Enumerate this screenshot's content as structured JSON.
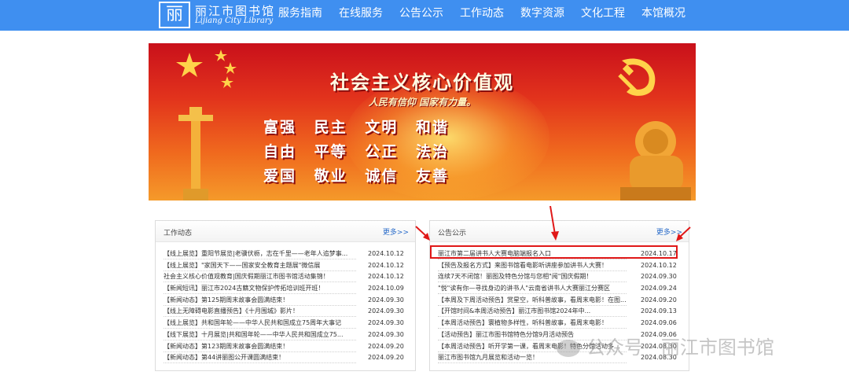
{
  "header": {
    "logo_glyph": "丽",
    "logo_cn": "丽江市图书馆",
    "logo_en": "Lijiang City Library",
    "nav": [
      "服务指南",
      "在线服务",
      "公告公示",
      "工作动态",
      "数字资源",
      "文化工程",
      "本馆概况"
    ]
  },
  "banner": {
    "title": "社会主义核心价值观",
    "subtitle": "人民有信仰 国家有力量。",
    "row1": "富强 民主 文明 和谐",
    "row2": "自由 平等 公正 法治",
    "row3": "爱国 敬业 诚信 友善"
  },
  "work_news": {
    "title": "工作动态",
    "more": "更多>>",
    "items": [
      {
        "text": "【线上展览】重阳节展览|老骥伏枥，志在千里——老年人追梦事...",
        "date": "2024.10.12"
      },
      {
        "text": "【线上展览】\"家国天下——国家安全教育主题展\"微信展",
        "date": "2024.10.12"
      },
      {
        "text": "社会主义核心价值观教育|国庆假期丽江市图书馆活动集锦！",
        "date": "2024.10.12"
      },
      {
        "text": "【新闻短讯】丽江市2024古籍文物保护传拓培训班开班！",
        "date": "2024.10.09"
      },
      {
        "text": "【新闻动态】第125期周末故事会圆满结束！",
        "date": "2024.09.30"
      },
      {
        "text": "【线上无障碍电影直播预告】《十月围城》影片！",
        "date": "2024.09.30"
      },
      {
        "text": "【线上展览】共和国年轮——中华人民共和国成立75周年大事记",
        "date": "2024.09.30"
      },
      {
        "text": "【线下展览】十月展览|共和国年轮——中华人民共和国成立75...",
        "date": "2024.09.30"
      },
      {
        "text": "【新闻动态】第123期周末故事会圆满结束！",
        "date": "2024.09.20"
      },
      {
        "text": "【新闻动态】第44讲丽图公开课圆满结束！",
        "date": "2024.09.20"
      }
    ]
  },
  "announcements": {
    "title": "公告公示",
    "more": "更多>>",
    "items": [
      {
        "text": "丽江市第二届讲书人大赛电脑端报名入口",
        "date": "2024.10.17"
      },
      {
        "text": "【预告及报名方式】来图书馆看电影听讲座参加讲书人大赛！",
        "date": "2024.10.12"
      },
      {
        "text": "连续7天不闭馆！丽图及特色分馆与您相\"阅\"国庆假期！",
        "date": "2024.09.30"
      },
      {
        "text": "\"悦\"读有你—寻找身边的讲书人\"云南省讲书人大赛丽江分赛区",
        "date": "2024.09.24"
      },
      {
        "text": "【本周及下周活动预告】赏星空，听科普故事，看周末电影！在图...",
        "date": "2024.09.20"
      },
      {
        "text": "【开馆时间&本周活动预告】丽江市图书馆2024年中...",
        "date": "2024.09.13"
      },
      {
        "text": "【本周活动预告】寰植物多样性，听科普故事，看周末电影！",
        "date": "2024.09.06"
      },
      {
        "text": "【活动预告】丽江市图书馆特色分馆9月活动预告",
        "date": "2024.09.06"
      },
      {
        "text": "【本周活动预告】听开学第一课，看周末电影！特色分馆活动多...",
        "date": "2024.08.30"
      },
      {
        "text": "丽江市图书馆九月展览和活动一览！",
        "date": "2024.08.30"
      }
    ]
  },
  "watermark": {
    "account": "公众号",
    "name": "丽江市图书馆"
  },
  "colors": {
    "topbar": "#3f8ff0",
    "link": "#2a6cc9",
    "highlight": "#e01818"
  }
}
